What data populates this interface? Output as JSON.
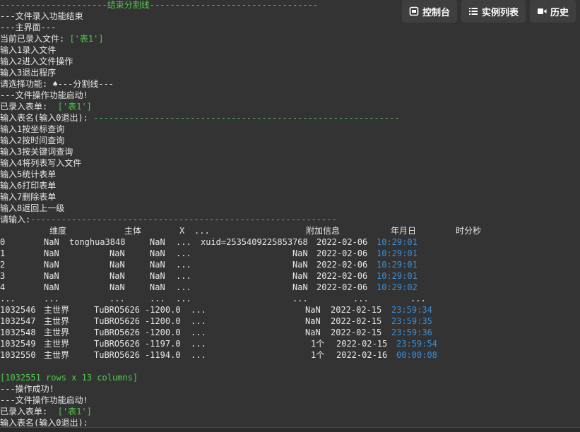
{
  "toolbar": {
    "console_label": "控制台",
    "instances_label": "实例列表",
    "history_label": "历史"
  },
  "console": {
    "lines": [
      {
        "text": "---------------------结束分割线---------------------------------",
        "color": "green"
      },
      {
        "text": "---文件录入功能结束",
        "color": "white"
      },
      {
        "text": "---主界面---",
        "color": "white"
      },
      {
        "prefix": "当前已录入文件: ",
        "value": "['表1']",
        "color": "white"
      },
      {
        "text": "输入1录入文件",
        "color": "white"
      },
      {
        "text": "输入2进入文件操作",
        "color": "white"
      },
      {
        "text": "输入3退出程序",
        "color": "white"
      },
      {
        "prefix": "请选择功能: ",
        "value": "---分割线---",
        "color": "white"
      },
      {
        "text": "---文件操作功能启动!",
        "color": "white"
      },
      {
        "prefix": "已录入表单:  ",
        "value": "['表1']",
        "color": "white"
      },
      {
        "prefix": "输入表名(输入0退出): ",
        "dashes": "------------------------------------------------------------",
        "color": "white"
      },
      {
        "text": "输入1按坐标查询",
        "color": "white"
      },
      {
        "text": "输入2按时间查询",
        "color": "white"
      },
      {
        "text": "输入3按关键词查询",
        "color": "white"
      },
      {
        "text": "输入4将列表写入文件",
        "color": "white"
      },
      {
        "text": "输入5统计表单",
        "color": "white"
      },
      {
        "text": "输入6打印表单",
        "color": "white"
      },
      {
        "text": "输入7删除表单",
        "color": "white"
      },
      {
        "text": "输入8返回上一级",
        "color": "white"
      },
      {
        "prefix": "请输入:",
        "dashes": "------------------------------------------------------------",
        "color": "white"
      }
    ]
  },
  "table": {
    "header": {
      "dim": "维度",
      "main": "主体",
      "x": "X",
      "dots": "...",
      "extra": "附加信息",
      "date": "年月日",
      "time": "时分秒"
    },
    "top_rows": [
      {
        "idx": "0",
        "dim": "NaN",
        "main": "tonghua3848",
        "x": "NaN",
        "dots": "...",
        "xuid": "xuid=2535409225853768",
        "extra": "",
        "date": "2022-02-06",
        "time": "10:29:01"
      },
      {
        "idx": "1",
        "dim": "NaN",
        "main": "NaN",
        "x": "NaN",
        "dots": "...",
        "xuid": "",
        "extra": "NaN",
        "date": "2022-02-06",
        "time": "10:29:01"
      },
      {
        "idx": "2",
        "dim": "NaN",
        "main": "NaN",
        "x": "NaN",
        "dots": "...",
        "xuid": "",
        "extra": "NaN",
        "date": "2022-02-06",
        "time": "10:29:01"
      },
      {
        "idx": "3",
        "dim": "NaN",
        "main": "NaN",
        "x": "NaN",
        "dots": "...",
        "xuid": "",
        "extra": "NaN",
        "date": "2022-02-06",
        "time": "10:29:01"
      },
      {
        "idx": "4",
        "dim": "NaN",
        "main": "NaN",
        "x": "NaN",
        "dots": "...",
        "xuid": "",
        "extra": "NaN",
        "date": "2022-02-06",
        "time": "10:29:02"
      }
    ],
    "ellipsis_row": {
      "idx": "...",
      "dim": "...",
      "main": "...",
      "x": "...",
      "dots": "...",
      "extra": "...",
      "date": "...",
      "time": "..."
    },
    "bottom_rows": [
      {
        "idx": "1032546",
        "dim": "主世界",
        "main": "TuBRO5626",
        "x": "-1200.0",
        "dots": "...",
        "extra": "NaN",
        "date": "2022-02-15",
        "time": "23:59:34"
      },
      {
        "idx": "1032547",
        "dim": "主世界",
        "main": "TuBRO5626",
        "x": "-1200.0",
        "dots": "...",
        "extra": "NaN",
        "date": "2022-02-15",
        "time": "23:59:35"
      },
      {
        "idx": "1032548",
        "dim": "主世界",
        "main": "TuBRO5626",
        "x": "-1200.0",
        "dots": "...",
        "extra": "NaN",
        "date": "2022-02-15",
        "time": "23:59:36"
      },
      {
        "idx": "1032549",
        "dim": "主世界",
        "main": "TuBRO5626",
        "x": "-1197.0",
        "dots": "...",
        "extra": "1个",
        "date": "2022-02-15",
        "time": "23:59:54"
      },
      {
        "idx": "1032550",
        "dim": "主世界",
        "main": "TuBRO5626",
        "x": "-1194.0",
        "dots": "...",
        "extra": "1个",
        "date": "2022-02-16",
        "time": "00:00:08"
      }
    ],
    "summary": "[1032551 rows x 13 columns]"
  },
  "tail": {
    "success": "---操作成功!",
    "restart": "---文件操作功能启动!",
    "registered_prefix": "已录入表单:  ",
    "registered_value": "['表1']",
    "prompt": "输入表名(输入0退出):"
  },
  "colors": {
    "background": "#333333",
    "text": "#e8e8e8",
    "green": "#4ec94e",
    "blue": "#3a8fd8",
    "button_bg": "#3f3f3f"
  }
}
